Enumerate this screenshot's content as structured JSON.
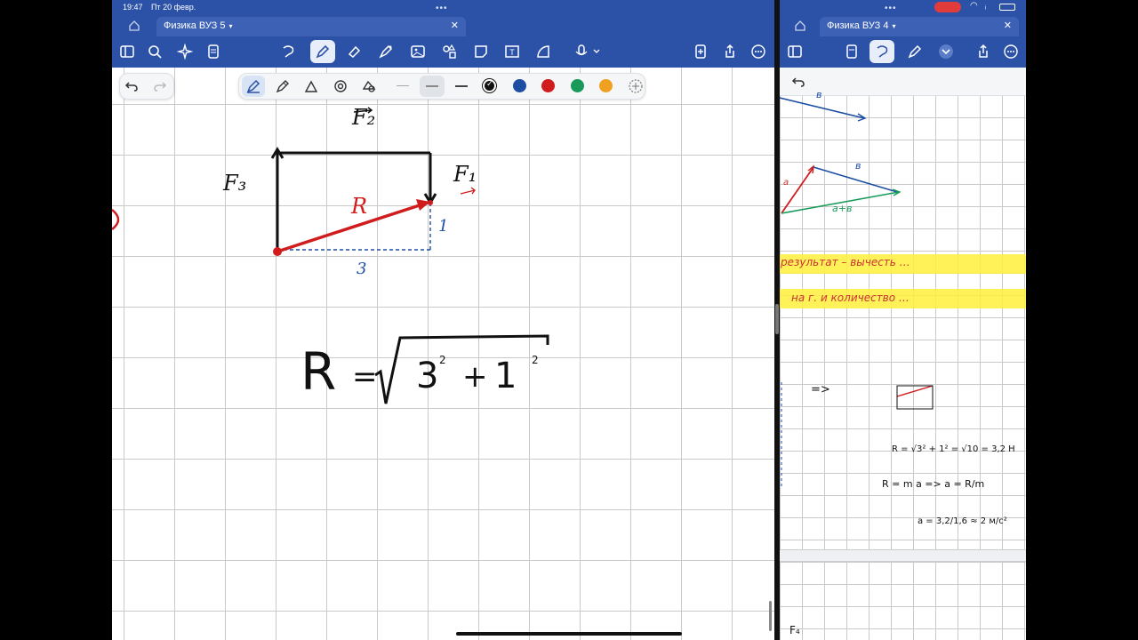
{
  "status_bar": {
    "time": "19:47",
    "date": "Пт 20 февр."
  },
  "left_pane": {
    "tab_title": "Физика ВУЗ 5",
    "colors": [
      "#111111",
      "#1c4ea3",
      "#d01c1c",
      "#1a9a5a",
      "#f0a020"
    ]
  },
  "right_pane": {
    "tab_title": "Физика ВУЗ 4"
  },
  "diagram": {
    "labels": {
      "f1": "F₁",
      "f2": "F₂",
      "f3": "F₃",
      "r": "R",
      "dx": "3",
      "dy": "1"
    },
    "formula": {
      "lhs": "R",
      "eq": "=",
      "a": "3",
      "b": "1",
      "exp": "2",
      "plus": "+"
    }
  },
  "right_notes": {
    "vec_b_top": "в",
    "vec_a": "a",
    "vec_b": "в",
    "vec_sum": "a+в",
    "arrow_implies": "=>",
    "formula_r": "R = √3² + 1² = √10 = 3,2 Н",
    "formula_f": "R = m a   =>   a = R/m",
    "formula_a": "a = 3,2/1,6 ≈ 2 м/с²",
    "hl_line1": "результат – вычесть …",
    "hl_line2": "на г.  и  количество …",
    "f4": "F₄"
  }
}
